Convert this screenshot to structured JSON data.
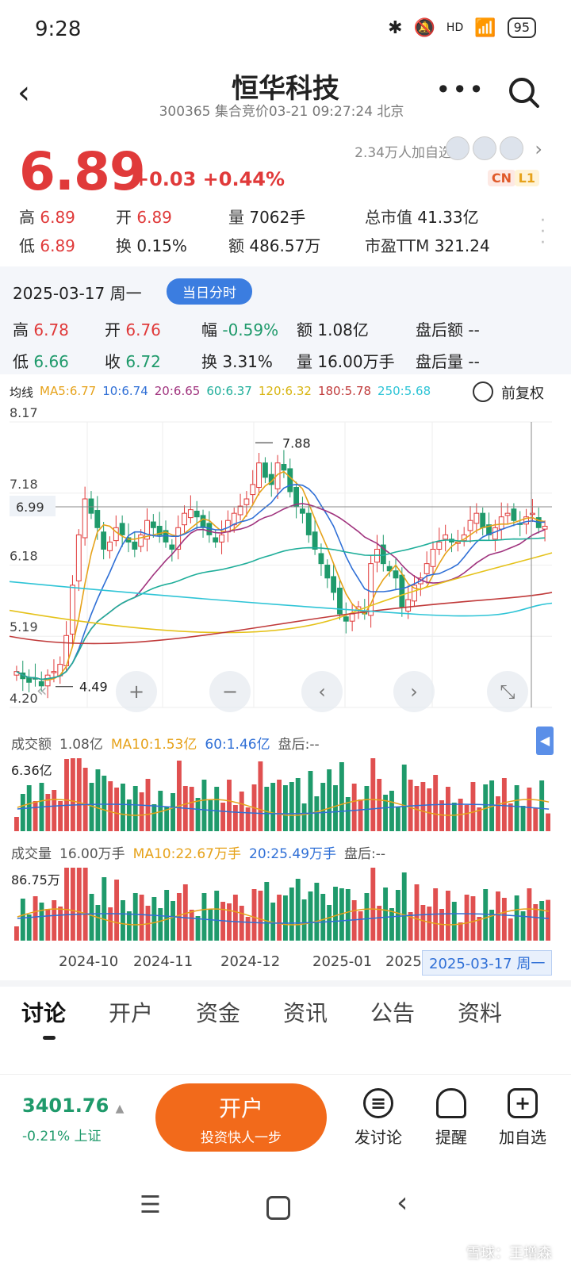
{
  "status": {
    "time": "9:28",
    "battery": "95",
    "net": "HD"
  },
  "header": {
    "title": "恒华科技",
    "subtitle": "300365 集合竞价03-21 09:27:24 北京",
    "more_icon": "more-icon",
    "search_icon": "search-icon"
  },
  "quote": {
    "price": "6.89",
    "change": "+0.03 +0.44%",
    "followers": "2.34万人加自选",
    "badge_cn": "CN",
    "badge_l1": "L1",
    "high_lbl": "高",
    "high": "6.89",
    "open_lbl": "开",
    "open": "6.89",
    "vol_lbl": "量",
    "vol": "7062手",
    "mcap_lbl": "总市值",
    "mcap": "41.33亿",
    "low_lbl": "低",
    "low": "6.89",
    "turn_lbl": "换",
    "turn": "0.15%",
    "amt_lbl": "额",
    "amt": "486.57万",
    "pe_lbl": "市盈TTM",
    "pe": "321.24"
  },
  "day": {
    "date": "2025-03-17 周一",
    "pill": "当日分时",
    "high_lbl": "高",
    "high": "6.78",
    "open_lbl": "开",
    "open": "6.76",
    "amp_lbl": "幅",
    "amp": "-0.59%",
    "amt_lbl": "额",
    "amt": "1.08亿",
    "after_amt_lbl": "盘后额",
    "after_amt": "--",
    "low_lbl": "低",
    "low": "6.66",
    "close_lbl": "收",
    "close": "6.72",
    "turn_lbl": "换",
    "turn": "3.31%",
    "vol_lbl": "量",
    "vol": "16.00万手",
    "after_vol_lbl": "盘后量",
    "after_vol": "--"
  },
  "ma": {
    "label": "均线",
    "items": [
      {
        "text": "MA5:6.77",
        "color": "#e6a21a"
      },
      {
        "text": "10:6.74",
        "color": "#2f6fd6"
      },
      {
        "text": "20:6.65",
        "color": "#a0337e"
      },
      {
        "text": "60:6.37",
        "color": "#1fae9a"
      },
      {
        "text": "120:6.32",
        "color": "#e5c21a"
      },
      {
        "text": "180:5.78",
        "color": "#c03a3a"
      },
      {
        "text": "250:5.68",
        "color": "#2ec4d6"
      }
    ],
    "adjust": "前复权"
  },
  "chart_data": {
    "type": "candlestick",
    "y_ticks": [
      "8.17",
      "7.18",
      "6.18",
      "5.19",
      "4.20"
    ],
    "ylim": [
      4.2,
      8.17
    ],
    "crosshair_price": "6.99",
    "high_marker": "7.88",
    "low_marker": "4.49",
    "x_ticks": [
      "2024-10",
      "2024-11",
      "2024-12",
      "2025-01",
      "2025"
    ],
    "cursor_date": "2025-03-17 周一",
    "closes": [
      4.7,
      4.6,
      4.55,
      4.6,
      4.5,
      4.65,
      4.7,
      4.8,
      5.2,
      5.9,
      6.6,
      7.1,
      6.9,
      6.7,
      6.4,
      6.5,
      6.7,
      6.6,
      6.5,
      6.4,
      6.6,
      6.8,
      6.7,
      6.6,
      6.5,
      6.4,
      6.7,
      6.9,
      6.95,
      6.85,
      6.7,
      6.6,
      6.5,
      6.6,
      6.8,
      6.9,
      7.0,
      7.1,
      7.3,
      7.6,
      7.4,
      7.3,
      7.6,
      7.5,
      7.2,
      7.0,
      6.9,
      6.6,
      6.4,
      6.2,
      6.0,
      5.8,
      5.5,
      5.4,
      5.5,
      5.6,
      5.5,
      6.2,
      6.4,
      6.2,
      6.1,
      6.0,
      5.6,
      5.7,
      5.9,
      6.0,
      6.2,
      6.4,
      6.5,
      6.6,
      6.5,
      6.5,
      6.6,
      6.8,
      6.9,
      6.7,
      6.6,
      6.7,
      6.85,
      6.9,
      6.8,
      6.75,
      6.85,
      6.9,
      6.7,
      6.72
    ]
  },
  "turnover": {
    "label": "成交额",
    "v1": "1.08亿",
    "v2": "MA10:1.53亿",
    "v3": "60:1.46亿",
    "v4": "盘后:--",
    "max": "6.36亿"
  },
  "volume": {
    "label": "成交量",
    "v1": "16.00万手",
    "v2": "MA10:22.67万手",
    "v3": "20:25.49万手",
    "v4": "盘后:--",
    "max": "86.75万"
  },
  "tabs": [
    "讨论",
    "开户",
    "资金",
    "资讯",
    "公告",
    "资料"
  ],
  "bottom": {
    "index_value": "3401.76",
    "index_change": "-0.21% 上证",
    "open_btn": "开户",
    "open_sub": "投资快人一步",
    "discuss": "发讨论",
    "remind": "提醒",
    "watch": "加自选"
  },
  "watermark": "雪球：王增森"
}
